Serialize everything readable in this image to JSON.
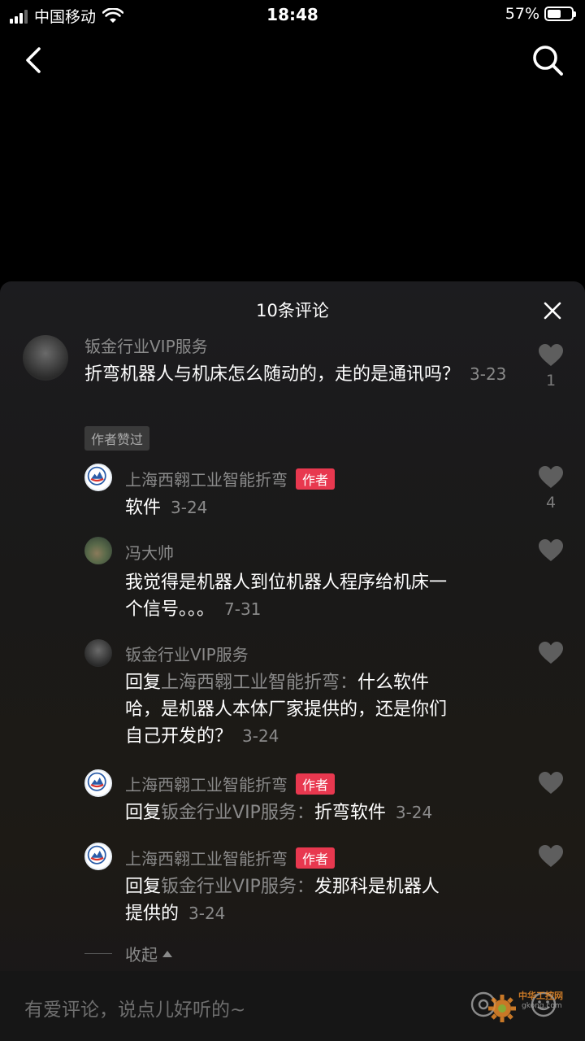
{
  "status_bar": {
    "carrier": "中国移动",
    "time": "18:48",
    "battery": "57%",
    "battery_level": 0.57
  },
  "sheet": {
    "title": "10条评论"
  },
  "comments": [
    {
      "user": "钣金行业VIP服务",
      "text": "折弯机器人与机床怎么随动的，走的是通讯吗？",
      "date": "3-23",
      "likes": "1",
      "tag": "作者赞过"
    }
  ],
  "replies": [
    {
      "user": "上海西翱工业智能折弯",
      "badge": "作者",
      "text": "软件",
      "date": "3-24",
      "likes": "4"
    },
    {
      "user": "冯大帅",
      "text_line1": "我觉得是机器人到位机器人程序给机床一",
      "text_line2": "个信号。。。",
      "date": "7-31"
    },
    {
      "user": "钣金行业VIP服务",
      "reply_prefix": "回复",
      "reply_to": "上海西翱工业智能折弯：",
      "text_line1": "什么软件",
      "text_line2": "哈，是机器人本体厂家提供的，还是你们",
      "text_line3": "自己开发的？",
      "date": "3-24"
    },
    {
      "user": "上海西翱工业智能折弯",
      "badge": "作者",
      "reply_prefix": "回复",
      "reply_to": "钣金行业VIP服务：",
      "text": "折弯软件",
      "date": "3-24"
    },
    {
      "user": "上海西翱工业智能折弯",
      "badge": "作者",
      "reply_prefix": "回复",
      "reply_to": "钣金行业VIP服务：",
      "text_line1": "发那科是机器人",
      "text_line2": "提供的",
      "date": "3-24"
    }
  ],
  "collapse_label": "收起",
  "input": {
    "placeholder": "有爱评论，说点儿好听的~"
  },
  "watermark": {
    "text": "中华工控网",
    "url": "gkong.com"
  },
  "icons": {
    "back": "chevron-left-icon",
    "search": "search-icon",
    "close": "close-icon",
    "like": "heart-icon",
    "mention": "at-icon",
    "emoji": "emoji-icon"
  },
  "colors": {
    "author_badge": "#e8384f",
    "secondary_text": "#8a8a8a"
  }
}
